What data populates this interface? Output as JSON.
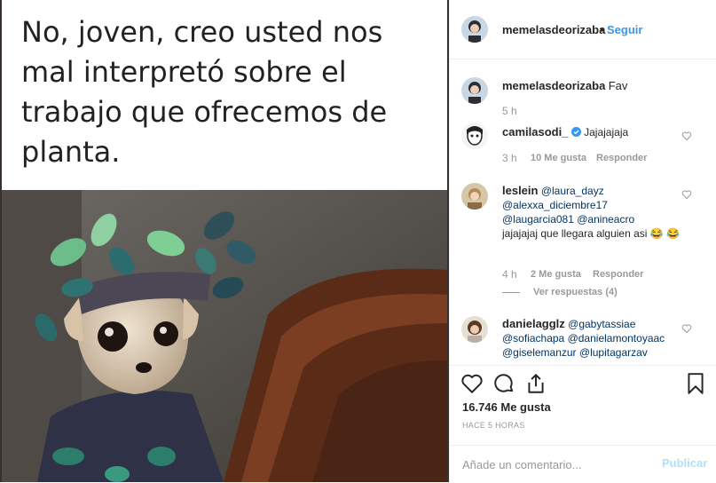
{
  "post": {
    "meme_text": "No, joven, creo usted nos mal interpretó sobre el trabajo que ofrecemos de planta."
  },
  "header": {
    "username": "memelasdeorizaba",
    "dot": "•",
    "follow_label": "Seguir"
  },
  "caption": {
    "username": "memelasdeorizaba",
    "text": "Fav",
    "time": "5 h"
  },
  "comments": [
    {
      "username": "camilasodi_",
      "text": "Jajajajaja",
      "time": "3 h",
      "likes": "10 Me gusta",
      "reply_label": "Responder"
    },
    {
      "username": "leslein",
      "mention1": "@laura_dayz",
      "mention2": "@alexxa_diciembre17",
      "mention3": "@laugarcia081",
      "mention4": "@anineacro",
      "text": "jajajajaj que llegara alguien asi 😂 😂",
      "time": "4 h",
      "likes": "2 Me gusta",
      "reply_label": "Responder",
      "view_replies": "Ver respuestas (4)"
    },
    {
      "username": "danielagglz",
      "mention1": "@gabytassiae",
      "mention2": "@sofiachapa",
      "mention3": "@danielamontoyaac",
      "mention4": "@giselemanzur",
      "mention5": "@lupitagarzav"
    }
  ],
  "footer": {
    "likes": "16.746 Me gusta",
    "time_ago": "HACE 5 HORAS",
    "comment_placeholder": "Añade un comentario...",
    "publish_label": "Publicar"
  },
  "colors": {
    "link": "#003569",
    "follow": "#3897f0",
    "verified": "#3897f0",
    "muted": "#999999",
    "publish_disabled": "#b2dffc"
  },
  "icons": [
    "heart-icon",
    "comment-icon",
    "share-icon",
    "bookmark-icon",
    "verified-badge-icon"
  ]
}
